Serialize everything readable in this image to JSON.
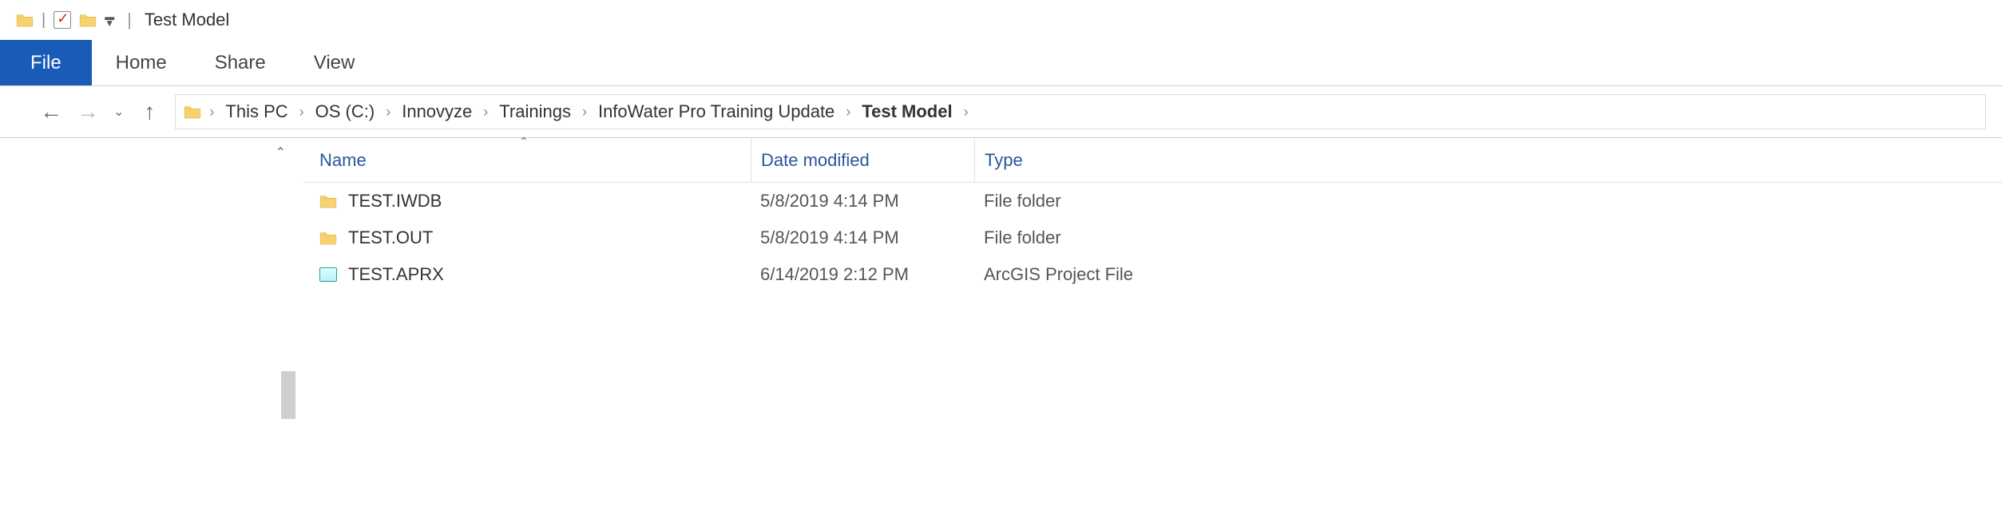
{
  "window": {
    "title": "Test Model"
  },
  "ribbon": {
    "file": "File",
    "tabs": [
      "Home",
      "Share",
      "View"
    ]
  },
  "breadcrumb": {
    "items": [
      "This PC",
      "OS (C:)",
      "Innovyze",
      "Trainings",
      "InfoWater Pro Training Update",
      "Test Model"
    ]
  },
  "columns": {
    "name": "Name",
    "date": "Date modified",
    "type": "Type"
  },
  "rows": [
    {
      "icon": "folder",
      "name": "TEST.IWDB",
      "date": "5/8/2019 4:14 PM",
      "type": "File folder"
    },
    {
      "icon": "folder",
      "name": "TEST.OUT",
      "date": "5/8/2019 4:14 PM",
      "type": "File folder"
    },
    {
      "icon": "aprx",
      "name": "TEST.APRX",
      "date": "6/14/2019 2:12 PM",
      "type": "ArcGIS Project File"
    }
  ]
}
